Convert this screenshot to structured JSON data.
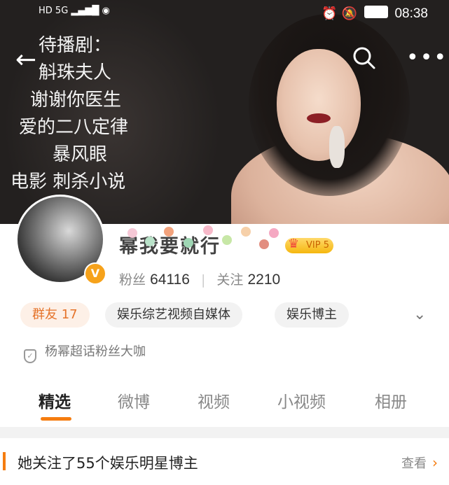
{
  "status_bar": {
    "left": "HD 5G ▂▄▆█ ◉",
    "time": "08:38"
  },
  "nav": {
    "back_icon": "back-arrow-icon",
    "search_icon": "search-icon",
    "more_icon": "more-icon"
  },
  "cover_text": {
    "lines": [
      "待播剧：",
      "斛珠夫人",
      "谢谢你医生",
      "爱的二八定律",
      "暴风眼",
      "电影 刺杀小说"
    ]
  },
  "profile": {
    "name": "幂我要就行",
    "vip_label": "VIP 5",
    "followers_label": "粉丝",
    "followers": "64116",
    "following_label": "关注",
    "following": "2210"
  },
  "tags": [
    {
      "label": "群友 17"
    },
    {
      "label": "娱乐综艺视频自媒体"
    },
    {
      "label": "娱乐博主"
    }
  ],
  "super_chat": "杨幂超话粉丝大咖",
  "tabs": [
    {
      "label": "精选"
    },
    {
      "label": "微博"
    },
    {
      "label": "视频"
    },
    {
      "label": "小视频"
    },
    {
      "label": "相册"
    }
  ],
  "notice": {
    "text": "她关注了55个娱乐明星博主",
    "link": "查看"
  },
  "colors": {
    "accent": "#f57c0f",
    "vip_gold": "#f5b70f"
  }
}
